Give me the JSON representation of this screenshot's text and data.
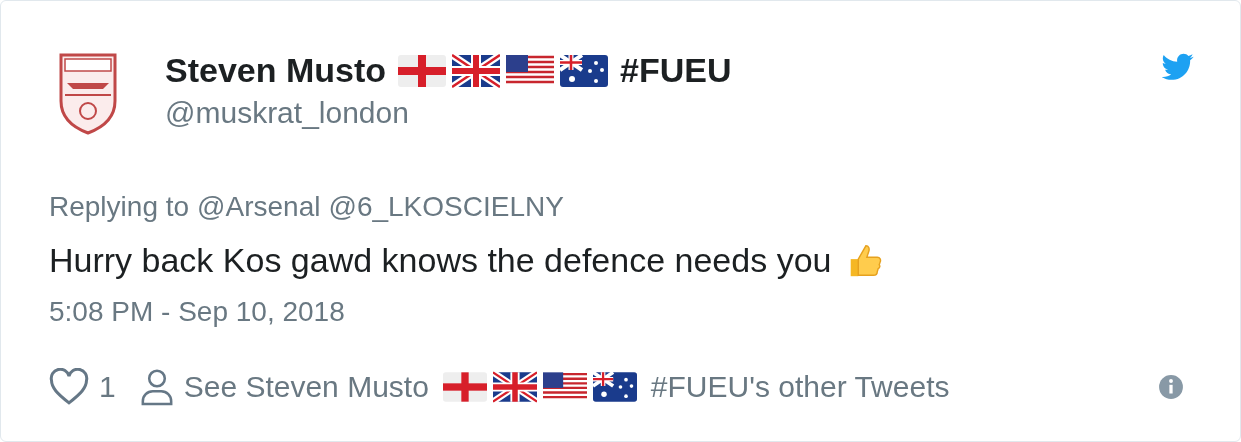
{
  "author": {
    "name": "Steven Musto",
    "name_suffix": "#FUEU",
    "handle": "@muskrat_london"
  },
  "reply_context": {
    "prefix": "Replying to",
    "mentions": [
      "@Arsenal",
      "@6_LKOSCIELNY"
    ]
  },
  "tweet": {
    "text": "Hurry back Kos gawd knows the defence needs you",
    "timestamp": "5:08 PM - Sep 10, 2018"
  },
  "footer": {
    "like_count": "1",
    "profile_link_prefix": "See Steven Musto",
    "profile_link_suffix": "#FUEU's other Tweets"
  }
}
